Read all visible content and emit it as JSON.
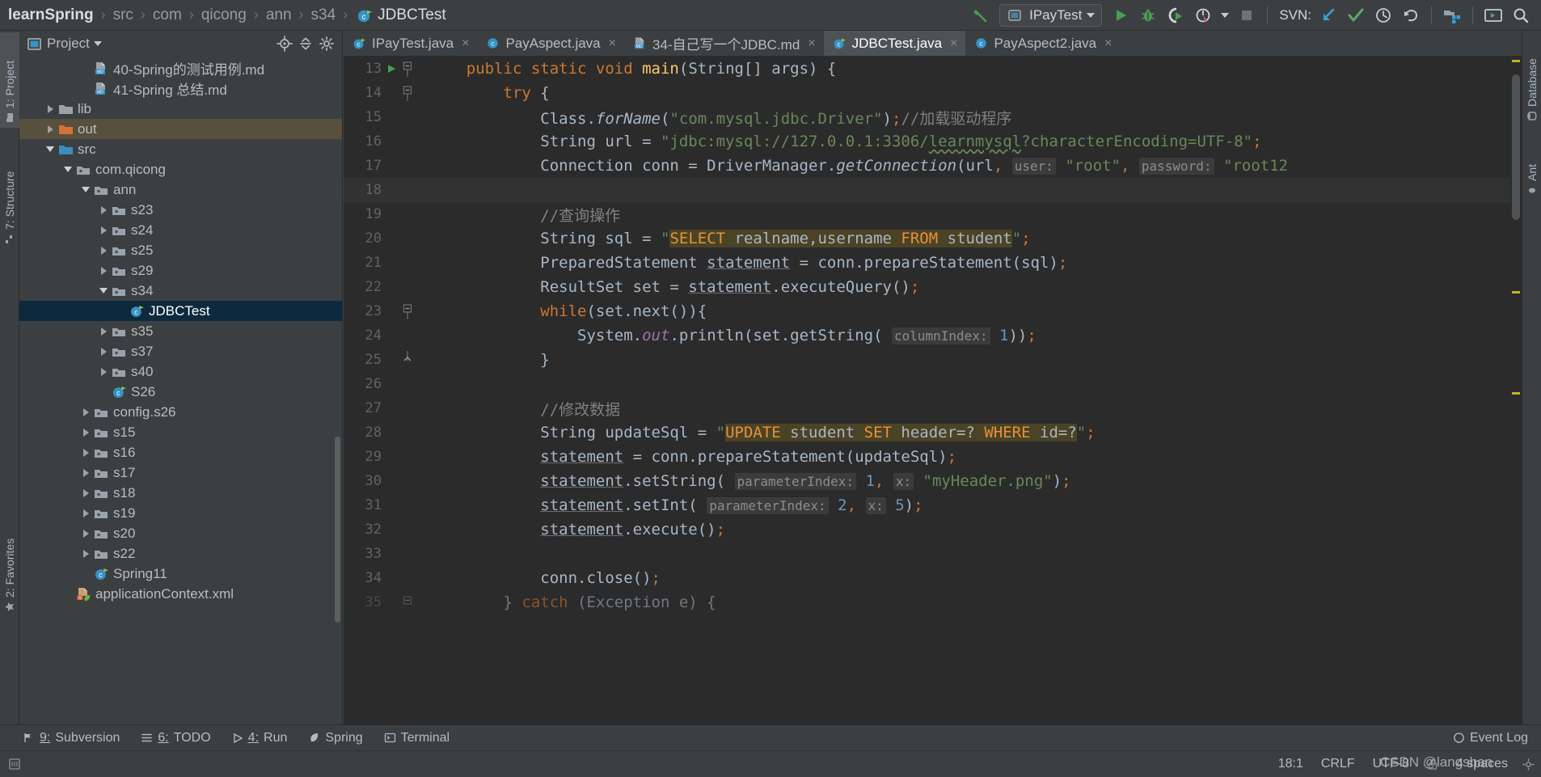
{
  "breadcrumb": {
    "items": [
      {
        "label": "learnSpring",
        "kind": "root"
      },
      {
        "label": "src",
        "kind": "dim"
      },
      {
        "label": "com",
        "kind": "dim"
      },
      {
        "label": "qicong",
        "kind": "dim"
      },
      {
        "label": "ann",
        "kind": "dim"
      },
      {
        "label": "s34",
        "kind": "dim"
      },
      {
        "label": "JDBCTest",
        "kind": "class"
      }
    ],
    "separator": "›"
  },
  "toolbar": {
    "build_icon": "hammer-icon",
    "run_config": {
      "name": "IPayTest",
      "icon": "run-config-icon"
    },
    "run_icon": "run-icon",
    "debug_icon": "debug-icon",
    "run_coverage_icon": "run-with-coverage-icon",
    "profiler_icon": "profiler-icon",
    "stop_icon": "stop-icon",
    "svn_label": "SVN:",
    "svn_update_icon": "svn-update-icon",
    "svn_commit_icon": "svn-commit-icon",
    "svn_history_icon": "svn-history-icon",
    "svn_rollback_icon": "svn-rollback-icon",
    "project_structure_icon": "project-structure-icon",
    "terminal_icon": "terminal-icon",
    "search_icon": "search-everywhere-icon"
  },
  "left_strip": {
    "tabs": [
      {
        "label": "1: Project",
        "icon": "project-icon",
        "selected": true
      },
      {
        "label": "7: Structure",
        "icon": "structure-icon",
        "selected": false
      },
      {
        "label": "2: Favorites",
        "icon": "star-icon",
        "selected": false
      }
    ]
  },
  "right_strip": {
    "tabs": [
      {
        "label": "Database",
        "icon": "database-icon"
      },
      {
        "label": "Ant",
        "icon": "ant-icon"
      }
    ]
  },
  "project_pane": {
    "title": "Project",
    "title_caret": "chevron-down-icon",
    "locate_icon": "locate-file-icon",
    "collapse_icon": "collapse-all-icon",
    "tree": [
      {
        "label": "40-Spring的测试用例.md",
        "indent": 3,
        "arrow": "none",
        "icon": "markdown-file-icon",
        "state": "normal"
      },
      {
        "label": "41-Spring 总结.md",
        "indent": 3,
        "arrow": "none",
        "icon": "markdown-file-icon",
        "state": "normal"
      },
      {
        "label": "lib",
        "indent": 1,
        "arrow": "right",
        "icon": "folder-gray-icon",
        "state": "normal"
      },
      {
        "label": "out",
        "indent": 1,
        "arrow": "right",
        "icon": "folder-orange-icon",
        "state": "highlight"
      },
      {
        "label": "src",
        "indent": 1,
        "arrow": "down",
        "icon": "folder-blue-icon",
        "state": "normal"
      },
      {
        "label": "com.qicong",
        "indent": 2,
        "arrow": "down",
        "icon": "package-icon",
        "state": "normal"
      },
      {
        "label": "ann",
        "indent": 3,
        "arrow": "down",
        "icon": "package-icon",
        "state": "normal"
      },
      {
        "label": "s23",
        "indent": 4,
        "arrow": "right",
        "icon": "package-icon",
        "state": "normal"
      },
      {
        "label": "s24",
        "indent": 4,
        "arrow": "right",
        "icon": "package-icon",
        "state": "normal"
      },
      {
        "label": "s25",
        "indent": 4,
        "arrow": "right",
        "icon": "package-icon",
        "state": "normal"
      },
      {
        "label": "s29",
        "indent": 4,
        "arrow": "right",
        "icon": "package-icon",
        "state": "normal"
      },
      {
        "label": "s34",
        "indent": 4,
        "arrow": "down",
        "icon": "package-icon",
        "state": "normal"
      },
      {
        "label": "JDBCTest",
        "indent": 5,
        "arrow": "none",
        "icon": "java-class-run-icon",
        "state": "selected"
      },
      {
        "label": "s35",
        "indent": 4,
        "arrow": "right",
        "icon": "package-icon",
        "state": "normal"
      },
      {
        "label": "s37",
        "indent": 4,
        "arrow": "right",
        "icon": "package-icon",
        "state": "normal"
      },
      {
        "label": "s40",
        "indent": 4,
        "arrow": "right",
        "icon": "package-icon",
        "state": "normal"
      },
      {
        "label": "S26",
        "indent": 4,
        "arrow": "none",
        "icon": "java-class-run-icon",
        "state": "normal"
      },
      {
        "label": "config.s26",
        "indent": 3,
        "arrow": "right",
        "icon": "package-icon",
        "state": "normal"
      },
      {
        "label": "s15",
        "indent": 3,
        "arrow": "right",
        "icon": "package-icon",
        "state": "normal"
      },
      {
        "label": "s16",
        "indent": 3,
        "arrow": "right",
        "icon": "package-icon",
        "state": "normal"
      },
      {
        "label": "s17",
        "indent": 3,
        "arrow": "right",
        "icon": "package-icon",
        "state": "normal"
      },
      {
        "label": "s18",
        "indent": 3,
        "arrow": "right",
        "icon": "package-icon",
        "state": "normal"
      },
      {
        "label": "s19",
        "indent": 3,
        "arrow": "right",
        "icon": "package-icon",
        "state": "normal"
      },
      {
        "label": "s20",
        "indent": 3,
        "arrow": "right",
        "icon": "package-icon",
        "state": "normal"
      },
      {
        "label": "s22",
        "indent": 3,
        "arrow": "right",
        "icon": "package-icon",
        "state": "normal"
      },
      {
        "label": "Spring11",
        "indent": 3,
        "arrow": "none",
        "icon": "java-class-run-icon",
        "state": "normal"
      },
      {
        "label": "applicationContext.xml",
        "indent": 2,
        "arrow": "none",
        "icon": "spring-xml-icon",
        "state": "normal"
      }
    ]
  },
  "editor_tabs": [
    {
      "label": "IPayTest.java",
      "icon": "java-class-run-icon",
      "active": false,
      "close": "×"
    },
    {
      "label": "PayAspect.java",
      "icon": "java-class-icon",
      "active": false,
      "close": "×"
    },
    {
      "label": "34-自己写一个JDBC.md",
      "icon": "markdown-file-icon",
      "active": false,
      "close": "×"
    },
    {
      "label": "JDBCTest.java",
      "icon": "java-class-run-icon",
      "active": true,
      "close": "×"
    },
    {
      "label": "PayAspect2.java",
      "icon": "java-class-icon",
      "active": false,
      "close": "×"
    }
  ],
  "code": {
    "first_line": 13,
    "lines": [
      {
        "n": 13,
        "gutter_run": true,
        "fold": "minus",
        "current": false
      },
      {
        "n": 14,
        "gutter_run": false,
        "fold": "minus",
        "current": false
      },
      {
        "n": 15,
        "gutter_run": false,
        "fold": "none",
        "current": false
      },
      {
        "n": 16,
        "gutter_run": false,
        "fold": "none",
        "current": false
      },
      {
        "n": 17,
        "gutter_run": false,
        "fold": "none",
        "current": false
      },
      {
        "n": 18,
        "gutter_run": false,
        "fold": "none",
        "current": true
      },
      {
        "n": 19,
        "gutter_run": false,
        "fold": "none",
        "current": false
      },
      {
        "n": 20,
        "gutter_run": false,
        "fold": "none",
        "current": false
      },
      {
        "n": 21,
        "gutter_run": false,
        "fold": "none",
        "current": false
      },
      {
        "n": 22,
        "gutter_run": false,
        "fold": "none",
        "current": false
      },
      {
        "n": 23,
        "gutter_run": false,
        "fold": "minus",
        "current": false
      },
      {
        "n": 24,
        "gutter_run": false,
        "fold": "none",
        "current": false
      },
      {
        "n": 25,
        "gutter_run": false,
        "fold": "end",
        "current": false
      },
      {
        "n": 26,
        "gutter_run": false,
        "fold": "none",
        "current": false
      },
      {
        "n": 27,
        "gutter_run": false,
        "fold": "none",
        "current": false
      },
      {
        "n": 28,
        "gutter_run": false,
        "fold": "none",
        "current": false
      },
      {
        "n": 29,
        "gutter_run": false,
        "fold": "none",
        "current": false
      },
      {
        "n": 30,
        "gutter_run": false,
        "fold": "none",
        "current": false
      },
      {
        "n": 31,
        "gutter_run": false,
        "fold": "none",
        "current": false
      },
      {
        "n": 32,
        "gutter_run": false,
        "fold": "none",
        "current": false
      },
      {
        "n": 33,
        "gutter_run": false,
        "fold": "none",
        "current": false
      },
      {
        "n": 34,
        "gutter_run": false,
        "fold": "none",
        "current": false
      },
      {
        "n": 35,
        "gutter_run": false,
        "fold": "minus",
        "current": false
      }
    ],
    "text": {
      "l13": "    public static void main(String[] args) {",
      "l14": "        try {",
      "l15": "            Class.forName(\"com.mysql.jdbc.Driver\");//加载驱动程序",
      "l16": "            String url = \"jdbc:mysql://127.0.0.1:3306/learnmysql?characterEncoding=UTF-8\";",
      "l17": "            Connection conn = DriverManager.getConnection(url, user: \"root\", password: \"root12",
      "l18": "",
      "l19": "            //查询操作",
      "l20": "            String sql = \"SELECT realname,username FROM student\";",
      "l21": "            PreparedStatement statement = conn.prepareStatement(sql);",
      "l22": "            ResultSet set = statement.executeQuery();",
      "l23": "            while(set.next()){",
      "l24": "                System.out.println(set.getString( columnIndex: 1));",
      "l25": "            }",
      "l26": "",
      "l27": "            //修改数据",
      "l28": "            String updateSql = \"UPDATE student SET header=? WHERE id=?\";",
      "l29": "            statement = conn.prepareStatement(updateSql);",
      "l30": "            statement.setString( parameterIndex: 1, x: \"myHeader.png\");",
      "l31": "            statement.setInt( parameterIndex: 2, x: 5);",
      "l32": "            statement.execute();",
      "l33": "",
      "l34": "            conn.close();",
      "l35": "        } catch (Exception e) {"
    },
    "inlay_hints": {
      "user": "user:",
      "password": "password:",
      "columnIndex": "columnIndex:",
      "parameterIndex": "parameterIndex:",
      "x": "x:"
    }
  },
  "bottom_tools": [
    {
      "mnemonic": "9:",
      "label": "Subversion",
      "icon": "subversion-icon"
    },
    {
      "mnemonic": "6:",
      "label": "TODO",
      "icon": "todo-icon"
    },
    {
      "mnemonic": "4:",
      "label": "Run",
      "icon": "run-icon"
    },
    {
      "mnemonic": "",
      "label": "Spring",
      "icon": "spring-leaf-icon"
    },
    {
      "mnemonic": "",
      "label": "Terminal",
      "icon": "terminal-icon"
    },
    {
      "mnemonic": "",
      "label": "Event Log",
      "icon": "event-log-icon"
    }
  ],
  "status_bar": {
    "caret_position": "18:1",
    "line_separator": "CRLF",
    "encoding": "UTF-8",
    "indent": "4 spaces",
    "lock_icon": "read-only-lock-icon",
    "memory_icon": "memory-indicator-icon"
  },
  "watermark": "CSDN @langshan",
  "colors": {
    "background": "#3c3f41",
    "editor_bg": "#2b2b2b",
    "accent_green": "#499c54",
    "accent_blue": "#3592c4",
    "selection_blue": "#0d293e",
    "highlight_tan": "#56503c",
    "string_green": "#6a8759",
    "keyword_orange": "#cc7832",
    "number_blue": "#6897bb",
    "comment_gray": "#808080",
    "sql_highlight": "#4b4325"
  }
}
